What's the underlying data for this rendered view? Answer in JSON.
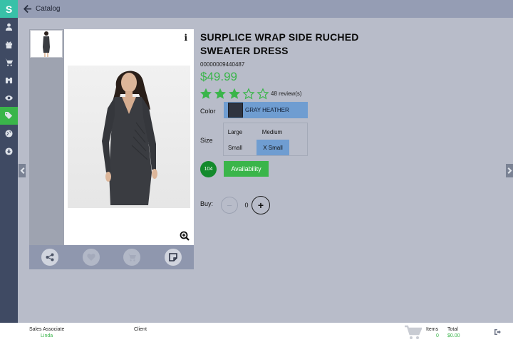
{
  "app": {
    "logo_text": "S"
  },
  "sidebar": {
    "items": [
      {
        "icon": "user-icon"
      },
      {
        "icon": "gift-icon"
      },
      {
        "icon": "cart-icon"
      },
      {
        "icon": "binoculars-icon"
      },
      {
        "icon": "eye-icon"
      },
      {
        "icon": "tags-icon",
        "active": true
      },
      {
        "icon": "globe-icon"
      },
      {
        "icon": "download-icon"
      }
    ]
  },
  "topbar": {
    "title": "Catalog"
  },
  "gallery": {
    "actions": [
      {
        "icon": "share-icon",
        "enabled": true
      },
      {
        "icon": "heart-icon",
        "enabled": false
      },
      {
        "icon": "cart-add-icon",
        "enabled": false
      },
      {
        "icon": "note-icon",
        "enabled": true
      }
    ]
  },
  "product": {
    "title": "SURPLICE WRAP SIDE RUCHED SWEATER DRESS",
    "sku": "00000009440487",
    "price": "$49.99",
    "rating": 3,
    "rating_max": 5,
    "reviews": "48 review(s)",
    "color_label": "Color",
    "color_value": "GRAY HEATHER",
    "size_label": "Size",
    "sizes": [
      "Large",
      "Medium",
      "Small",
      "X Small"
    ],
    "selected_size": "X Small",
    "stock": "104",
    "availability_label": "Availability",
    "buy_label": "Buy:",
    "quantity": "0",
    "minus": "−",
    "plus": "+"
  },
  "footer": {
    "sales_associate_label": "Sales Associate",
    "sales_associate_value": "Linda",
    "client_label": "Client",
    "items_label": "Items",
    "items_value": "0",
    "total_label": "Total",
    "total_value": "$0.00"
  },
  "colors": {
    "accent": "#3ab54a",
    "selection": "#6f9dd1",
    "sidebar": "#3f4a63",
    "topbar": "#959db4"
  }
}
